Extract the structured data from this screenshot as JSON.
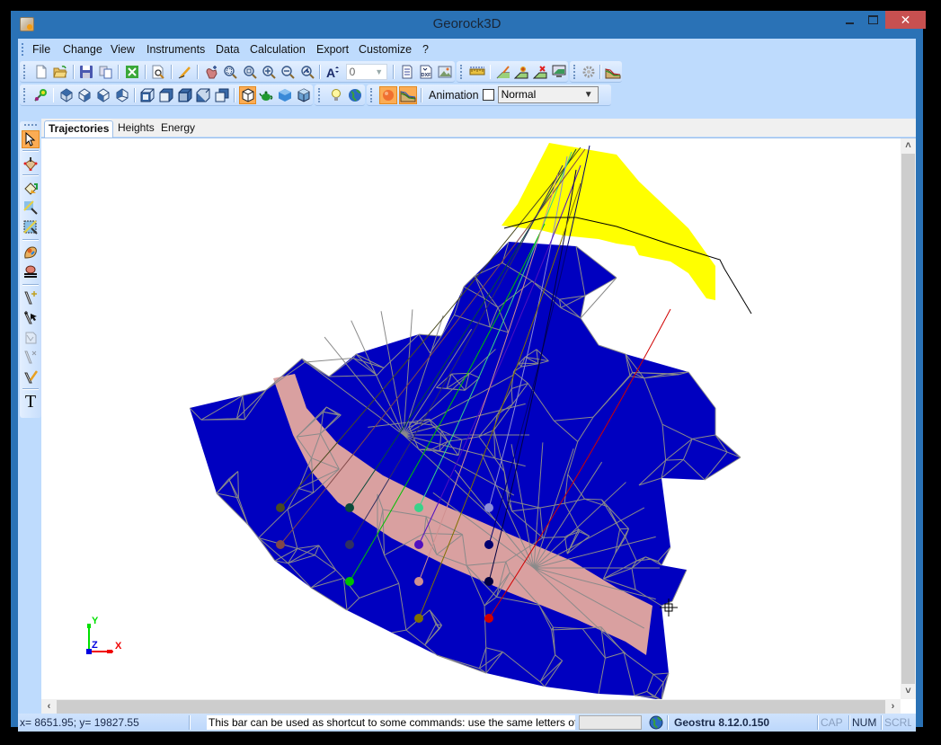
{
  "window": {
    "title": "Georock3D",
    "minimize_label": "minimize",
    "maximize_label": "maximize",
    "close_glyph": "✕"
  },
  "menubar": {
    "items": [
      {
        "label": "File"
      },
      {
        "label": "Change"
      },
      {
        "label": "View"
      },
      {
        "label": "Instruments"
      },
      {
        "label": "Data"
      },
      {
        "label": "Calculation"
      },
      {
        "label": "Export"
      },
      {
        "label": "Customize"
      },
      {
        "label": "?"
      }
    ]
  },
  "toolbar1": {
    "buttons": [
      {
        "icon": "new-file-icon"
      },
      {
        "icon": "open-folder-icon"
      },
      {
        "icon": "save-icon"
      },
      {
        "icon": "copy-icon"
      },
      {
        "icon": "export-excel-icon"
      },
      {
        "icon": "print-preview-icon"
      },
      {
        "icon": "pencil-icon"
      },
      {
        "icon": "pan-hand-icon"
      },
      {
        "icon": "zoom-extents-icon"
      },
      {
        "icon": "zoom-window-icon"
      },
      {
        "icon": "zoom-in-icon"
      },
      {
        "icon": "zoom-out-icon"
      },
      {
        "icon": "zoom-previous-icon"
      },
      {
        "icon": "font-size-icon"
      }
    ],
    "font_size_value": "0",
    "buttons_after": [
      {
        "icon": "document-icon"
      },
      {
        "icon": "dxf-icon"
      },
      {
        "icon": "image-icon"
      },
      {
        "icon": "ruler-icon"
      },
      {
        "icon": "edit-profile-icon"
      },
      {
        "icon": "add-profile-icon"
      },
      {
        "icon": "delete-profile-icon"
      },
      {
        "icon": "monitor-profile-icon"
      },
      {
        "icon": "settings-gear-icon"
      },
      {
        "icon": "slope-chart-icon"
      }
    ]
  },
  "toolbar2": {
    "buttons": [
      {
        "icon": "run-icon"
      },
      {
        "icon": "view-top-icon"
      },
      {
        "icon": "view-front-icon"
      },
      {
        "icon": "view-side-icon"
      },
      {
        "icon": "view-back-icon"
      },
      {
        "icon": "wireframe-box-1-icon"
      },
      {
        "icon": "wireframe-box-2-icon"
      },
      {
        "icon": "wireframe-box-3-icon"
      },
      {
        "icon": "wireframe-box-4-icon"
      },
      {
        "icon": "wireframe-box-5-icon"
      },
      {
        "icon": "cube-outline-icon",
        "active": true
      },
      {
        "icon": "teapot-icon"
      },
      {
        "icon": "solid-cube-icon"
      },
      {
        "icon": "shaded-cube-icon"
      },
      {
        "icon": "light-bulb-icon"
      },
      {
        "icon": "globe-icon"
      },
      {
        "icon": "sphere-icon",
        "active": true
      },
      {
        "icon": "slope-trajectory-icon",
        "active": true
      }
    ],
    "animation_label": "Animation",
    "animation_checked": false,
    "animation_speed": "Normal"
  },
  "left_toolbar": {
    "buttons": [
      {
        "icon": "pointer-arrow-icon",
        "active": true
      },
      {
        "icon": "point-grid-icon"
      },
      {
        "icon": "paint-bucket-icon"
      },
      {
        "icon": "magnify-map-icon"
      },
      {
        "icon": "magnify-select-icon"
      },
      {
        "icon": "rock-fall-icon"
      },
      {
        "icon": "barrier-icon"
      },
      {
        "icon": "add-line-icon"
      },
      {
        "icon": "select-line-icon"
      },
      {
        "icon": "disabled-map-icon"
      },
      {
        "icon": "delete-line-icon"
      },
      {
        "icon": "edit-line-icon"
      },
      {
        "icon": "text-tool-icon",
        "glyph": "T"
      }
    ]
  },
  "tabs": [
    {
      "label": "Trajectories",
      "active": true
    },
    {
      "label": "Heights",
      "active": false
    },
    {
      "label": "Energy",
      "active": false
    }
  ],
  "viewport": {
    "axes": {
      "x": "X",
      "y": "Y",
      "z": "Z"
    },
    "colors": {
      "terrain": "#0000c0",
      "source_zone": "#ffff00",
      "road_band": "#d9a0a0",
      "mesh_lines": "#8a8a8a"
    },
    "rock_markers": [
      {
        "color": "#4a4a20"
      },
      {
        "color": "#0a4a3a"
      },
      {
        "color": "#3ad28a"
      },
      {
        "color": "#8c8cd8"
      },
      {
        "color": "#804848"
      },
      {
        "color": "#303060"
      },
      {
        "color": "#5010c0"
      },
      {
        "color": "#000070"
      },
      {
        "color": "#00c000"
      },
      {
        "color": "#d09090"
      },
      {
        "color": "#000040"
      },
      {
        "color": "#807000"
      },
      {
        "color": "#d00000"
      }
    ]
  },
  "statusbar": {
    "coordinates": "x= 8651.95; y= 19827.55",
    "hint": "This bar can be used as shortcut to some commands: use the same letters of menu f",
    "product": "Geostru 8.12.0.150",
    "cap": "CAP",
    "num": "NUM",
    "scrl": "SCRL"
  }
}
